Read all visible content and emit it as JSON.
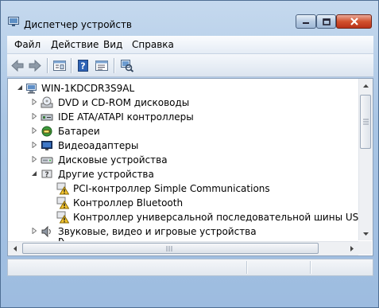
{
  "window": {
    "title": "Диспетчер устройств",
    "icon": "device-manager-icon"
  },
  "menu": [
    "Файл",
    "Действие",
    "Вид",
    "Справка"
  ],
  "toolbar": [
    "back-arrow-icon",
    "forward-arrow-icon",
    "properties-icon",
    "help-icon",
    "details-icon",
    "scan-hardware-icon"
  ],
  "tree": {
    "root": "WIN-1KDCDR3S9AL",
    "items": [
      {
        "label": "DVD и CD-ROM дисководы",
        "icon": "cdrom-icon",
        "expanded": false
      },
      {
        "label": "IDE ATA/ATAPI контроллеры",
        "icon": "ide-controller-icon",
        "expanded": false
      },
      {
        "label": "Батареи",
        "icon": "battery-icon",
        "expanded": false
      },
      {
        "label": "Видеоадаптеры",
        "icon": "display-adapter-icon",
        "expanded": false
      },
      {
        "label": "Дисковые устройства",
        "icon": "disk-drive-icon",
        "expanded": false
      },
      {
        "label": "Другие устройства",
        "icon": "unknown-device-icon",
        "expanded": true
      },
      {
        "label": "PCI-контроллер Simple Communications",
        "icon": "warning-device-icon",
        "child": true
      },
      {
        "label": "Контроллер Bluetooth",
        "icon": "warning-device-icon",
        "child": true
      },
      {
        "label": "Контроллер универсальной последовательной шины USB",
        "icon": "warning-device-icon",
        "child": true
      },
      {
        "label": "Звуковые, видео и игровые устройства",
        "icon": "sound-icon",
        "expanded": false
      },
      {
        "label": "К",
        "icon": "generic-device-icon",
        "expanded": false
      }
    ]
  },
  "colors": {
    "frame": "#a9c5e4",
    "close_button": "#d2512e",
    "warning": "#f4c430"
  }
}
